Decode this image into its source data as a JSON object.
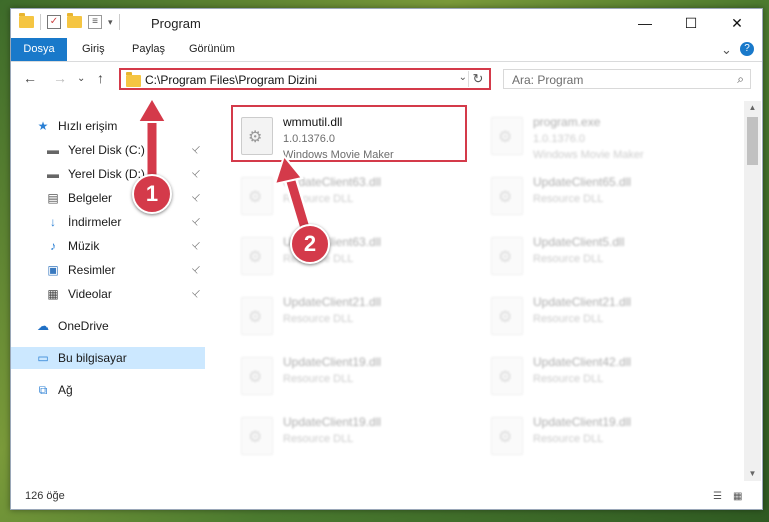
{
  "window": {
    "title": "Program"
  },
  "window_controls": {
    "minimize": "—",
    "maximize": "☐",
    "close": "✕"
  },
  "ribbon": {
    "tabs": [
      "Dosya",
      "Giriş",
      "Paylaş",
      "Görünüm"
    ],
    "expand": "⌄",
    "help": "?"
  },
  "nav": {
    "back": "←",
    "forward": "→",
    "recent": "⌄",
    "up": "↑"
  },
  "address": {
    "path": "C:\\Program Files\\Program Dizini",
    "dropdown": "⌄",
    "refresh": "↻"
  },
  "search": {
    "placeholder": "Ara: Program",
    "icon": "⌕"
  },
  "sidebar": {
    "items": [
      {
        "label": "Hızlı erişim",
        "icon": "star-icon",
        "glyph": "★",
        "color": "#2a7fd4"
      },
      {
        "label": "Yerel Disk (C:)",
        "icon": "drive-icon",
        "glyph": "▬",
        "color": "#666666",
        "pinned": true
      },
      {
        "label": "Yerel Disk (D:)",
        "icon": "drive-icon",
        "glyph": "▬",
        "color": "#666666",
        "pinned": true
      },
      {
        "label": "Belgeler",
        "icon": "document-icon",
        "glyph": "▤",
        "color": "#555555",
        "pinned": true
      },
      {
        "label": "İndirmeler",
        "icon": "download-icon",
        "glyph": "↓",
        "color": "#2a7fd4",
        "pinned": true
      },
      {
        "label": "Müzik",
        "icon": "music-icon",
        "glyph": "♪",
        "color": "#2a7fd4",
        "pinned": true
      },
      {
        "label": "Resimler",
        "icon": "pictures-icon",
        "glyph": "▣",
        "color": "#3a7ac0",
        "pinned": true
      },
      {
        "label": "Videolar",
        "icon": "video-icon",
        "glyph": "▦",
        "color": "#444444",
        "pinned": true
      },
      {
        "label": "OneDrive",
        "icon": "cloud-icon",
        "glyph": "☁",
        "color": "#1f6fc5"
      },
      {
        "label": "Bu bilgisayar",
        "icon": "computer-icon",
        "glyph": "▭",
        "color": "#2a7fd4",
        "selected": true
      },
      {
        "label": "Ağ",
        "icon": "network-icon",
        "glyph": "⧉",
        "color": "#2a7fd4"
      }
    ],
    "pin_glyph": "📌"
  },
  "files": {
    "highlighted": {
      "name": "wmmutil.dll",
      "version": "1.0.1376.0",
      "company": "Windows Movie Maker"
    },
    "blurred": [
      {
        "name": "program.exe",
        "line1": "1.0.1376.0",
        "line2": "Windows Movie Maker"
      },
      {
        "name": "UpdateClient63.dll",
        "line1": "Resource DLL"
      },
      {
        "name": "UpdateClient65.dll",
        "line1": "Resource DLL"
      },
      {
        "name": "UpdateClient63.dll",
        "line1": "Resource DLL"
      },
      {
        "name": "UpdateClient5.dll",
        "line1": "Resource DLL"
      },
      {
        "name": "UpdateClient21.dll",
        "line1": "Resource DLL"
      },
      {
        "name": "UpdateClient21.dll",
        "line1": "Resource DLL"
      },
      {
        "name": "UpdateClient19.dll",
        "line1": "Resource DLL"
      },
      {
        "name": "UpdateClient42.dll",
        "line1": "Resource DLL"
      },
      {
        "name": "UpdateClient19.dll",
        "line1": "Resource DLL"
      },
      {
        "name": "UpdateClient19.dll",
        "line1": "Resource DLL"
      }
    ]
  },
  "status": {
    "count": "126 öğe"
  },
  "annotations": {
    "step1": "1",
    "step2": "2",
    "color": "#d43a4a"
  }
}
